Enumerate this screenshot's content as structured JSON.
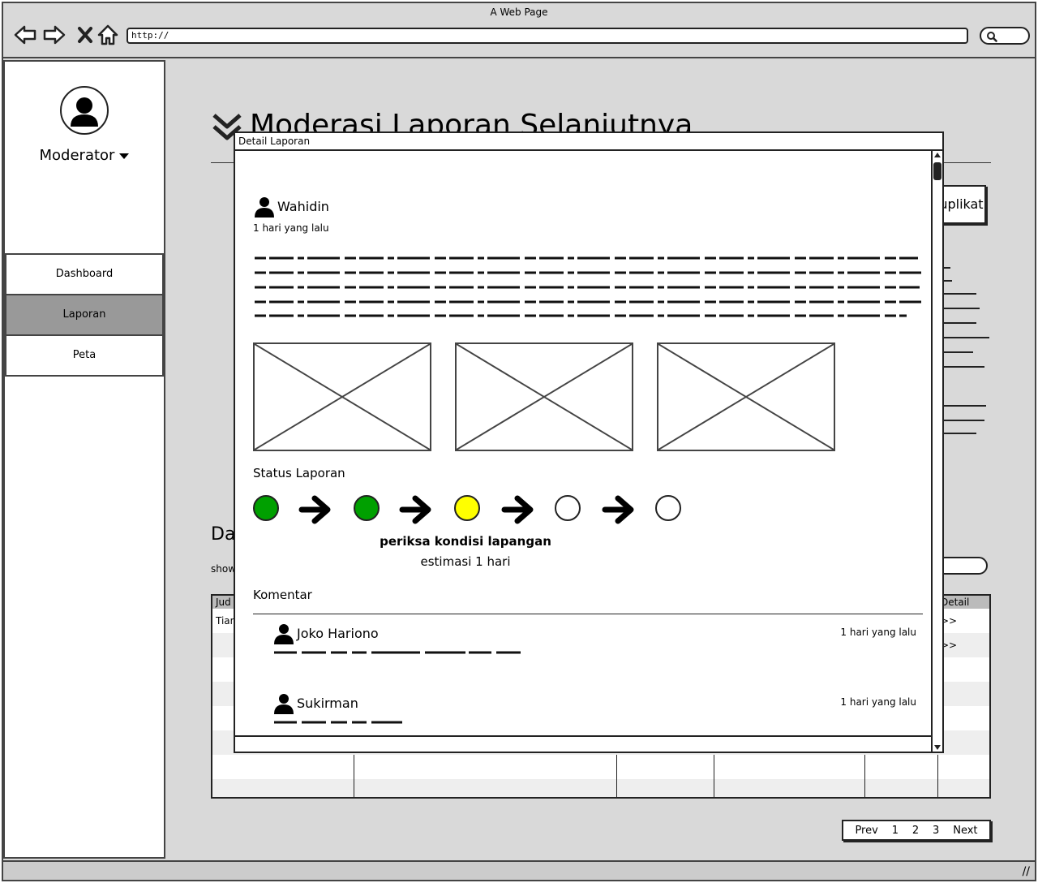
{
  "window": {
    "title": "A Web Page",
    "url": "http://"
  },
  "sidebar": {
    "user_label": "Moderator",
    "items": [
      {
        "label": "Dashboard",
        "active": false
      },
      {
        "label": "Laporan",
        "active": true
      },
      {
        "label": "Peta",
        "active": false
      }
    ]
  },
  "main": {
    "heading": "Moderasi Laporan Selanjutnya",
    "duplikat_button": "Duplikat",
    "section_heading": "Da",
    "show_label": "show",
    "table_header_first": "Jud",
    "table_header_last": "Detail",
    "table_cell_first": "Tian",
    "row_link_1": ">>",
    "row_link_2": ">>",
    "pagination": {
      "prev": "Prev",
      "pages": [
        "1",
        "2",
        "3"
      ],
      "next": "Next"
    }
  },
  "modal": {
    "title": "Detail Laporan",
    "author": "Wahidin",
    "time": "1 hari yang lalu",
    "status_label": "Status Laporan",
    "status_steps": [
      {
        "state": "done",
        "color": "#00a000"
      },
      {
        "state": "done",
        "color": "#00a000"
      },
      {
        "state": "current",
        "color": "#ffff00"
      },
      {
        "state": "pending",
        "color": "#ffffff"
      },
      {
        "state": "pending",
        "color": "#ffffff"
      }
    ],
    "current_step_name": "periksa kondisi lapangan",
    "current_step_estimate": "estimasi 1 hari",
    "komentar_label": "Komentar",
    "comments": [
      {
        "author": "Joko Hariono",
        "time": "1 hari yang lalu"
      },
      {
        "author": "Sukirman",
        "time": "1 hari yang lalu"
      }
    ]
  }
}
